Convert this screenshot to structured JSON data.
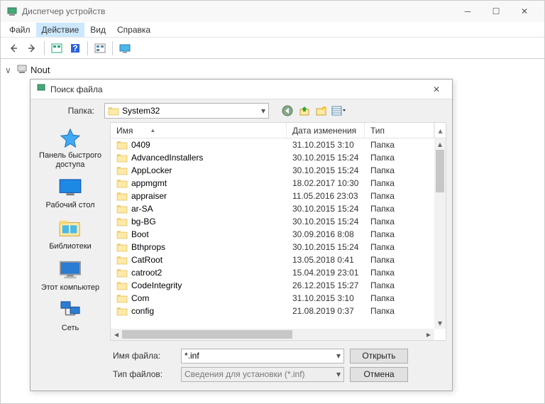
{
  "window": {
    "title": "Диспетчер устройств",
    "menus": [
      "Файл",
      "Действие",
      "Вид",
      "Справка"
    ],
    "active_menu_index": 1,
    "tree_root": "Nout"
  },
  "dialog": {
    "title": "Поиск файла",
    "folder_label": "Папка:",
    "current_folder": "System32",
    "columns": {
      "name": "Имя",
      "date": "Дата изменения",
      "type": "Тип"
    },
    "places": [
      {
        "id": "quick",
        "label": "Панель быстрого доступа"
      },
      {
        "id": "desktop",
        "label": "Рабочий стол"
      },
      {
        "id": "libraries",
        "label": "Библиотеки"
      },
      {
        "id": "thispc",
        "label": "Этот компьютер"
      },
      {
        "id": "network",
        "label": "Сеть"
      }
    ],
    "files": [
      {
        "name": "0409",
        "date": "31.10.2015 3:10",
        "type": "Папка"
      },
      {
        "name": "AdvancedInstallers",
        "date": "30.10.2015 15:24",
        "type": "Папка"
      },
      {
        "name": "AppLocker",
        "date": "30.10.2015 15:24",
        "type": "Папка"
      },
      {
        "name": "appmgmt",
        "date": "18.02.2017 10:30",
        "type": "Папка"
      },
      {
        "name": "appraiser",
        "date": "11.05.2016 23:03",
        "type": "Папка"
      },
      {
        "name": "ar-SA",
        "date": "30.10.2015 15:24",
        "type": "Папка"
      },
      {
        "name": "bg-BG",
        "date": "30.10.2015 15:24",
        "type": "Папка"
      },
      {
        "name": "Boot",
        "date": "30.09.2016 8:08",
        "type": "Папка"
      },
      {
        "name": "Bthprops",
        "date": "30.10.2015 15:24",
        "type": "Папка"
      },
      {
        "name": "CatRoot",
        "date": "13.05.2018 0:41",
        "type": "Папка"
      },
      {
        "name": "catroot2",
        "date": "15.04.2019 23:01",
        "type": "Папка"
      },
      {
        "name": "CodeIntegrity",
        "date": "26.12.2015 15:27",
        "type": "Папка"
      },
      {
        "name": "Com",
        "date": "31.10.2015 3:10",
        "type": "Папка"
      },
      {
        "name": "config",
        "date": "21.08.2019 0:37",
        "type": "Папка"
      }
    ],
    "filename_label": "Имя файла:",
    "filename_value": "*.inf",
    "filetype_label": "Тип файлов:",
    "filetype_value": "Сведения для установки (*.inf)",
    "open_btn": "Открыть",
    "cancel_btn": "Отмена"
  },
  "icons": {
    "back": "←",
    "fwd": "→",
    "up_tri": "▲",
    "dn_tri": "▼"
  }
}
